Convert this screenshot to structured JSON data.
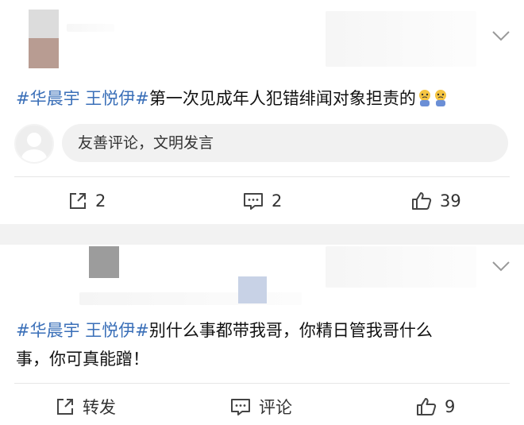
{
  "posts": [
    {
      "text_tag": "#华晨宇 王悦伊#",
      "text_body": "第一次见成年人犯错绯闻对象担责的",
      "emojis": [
        "crying-emoji",
        "crying-emoji"
      ],
      "comment_placeholder": "友善评论，文明发言",
      "actions": {
        "share": "2",
        "comment": "2",
        "like": "39"
      }
    },
    {
      "text_tag": "#华晨宇 王悦伊#",
      "text_body_line1": "别什么事都带我哥，你精日管我哥什么",
      "text_body_line2": "事，你可真能蹭！",
      "actions": {
        "share": "转发",
        "comment": "评论",
        "like": "9"
      }
    }
  ],
  "colors": {
    "hashtag": "#3a6fb8",
    "text": "#111111",
    "background": "#f2f2f2"
  }
}
